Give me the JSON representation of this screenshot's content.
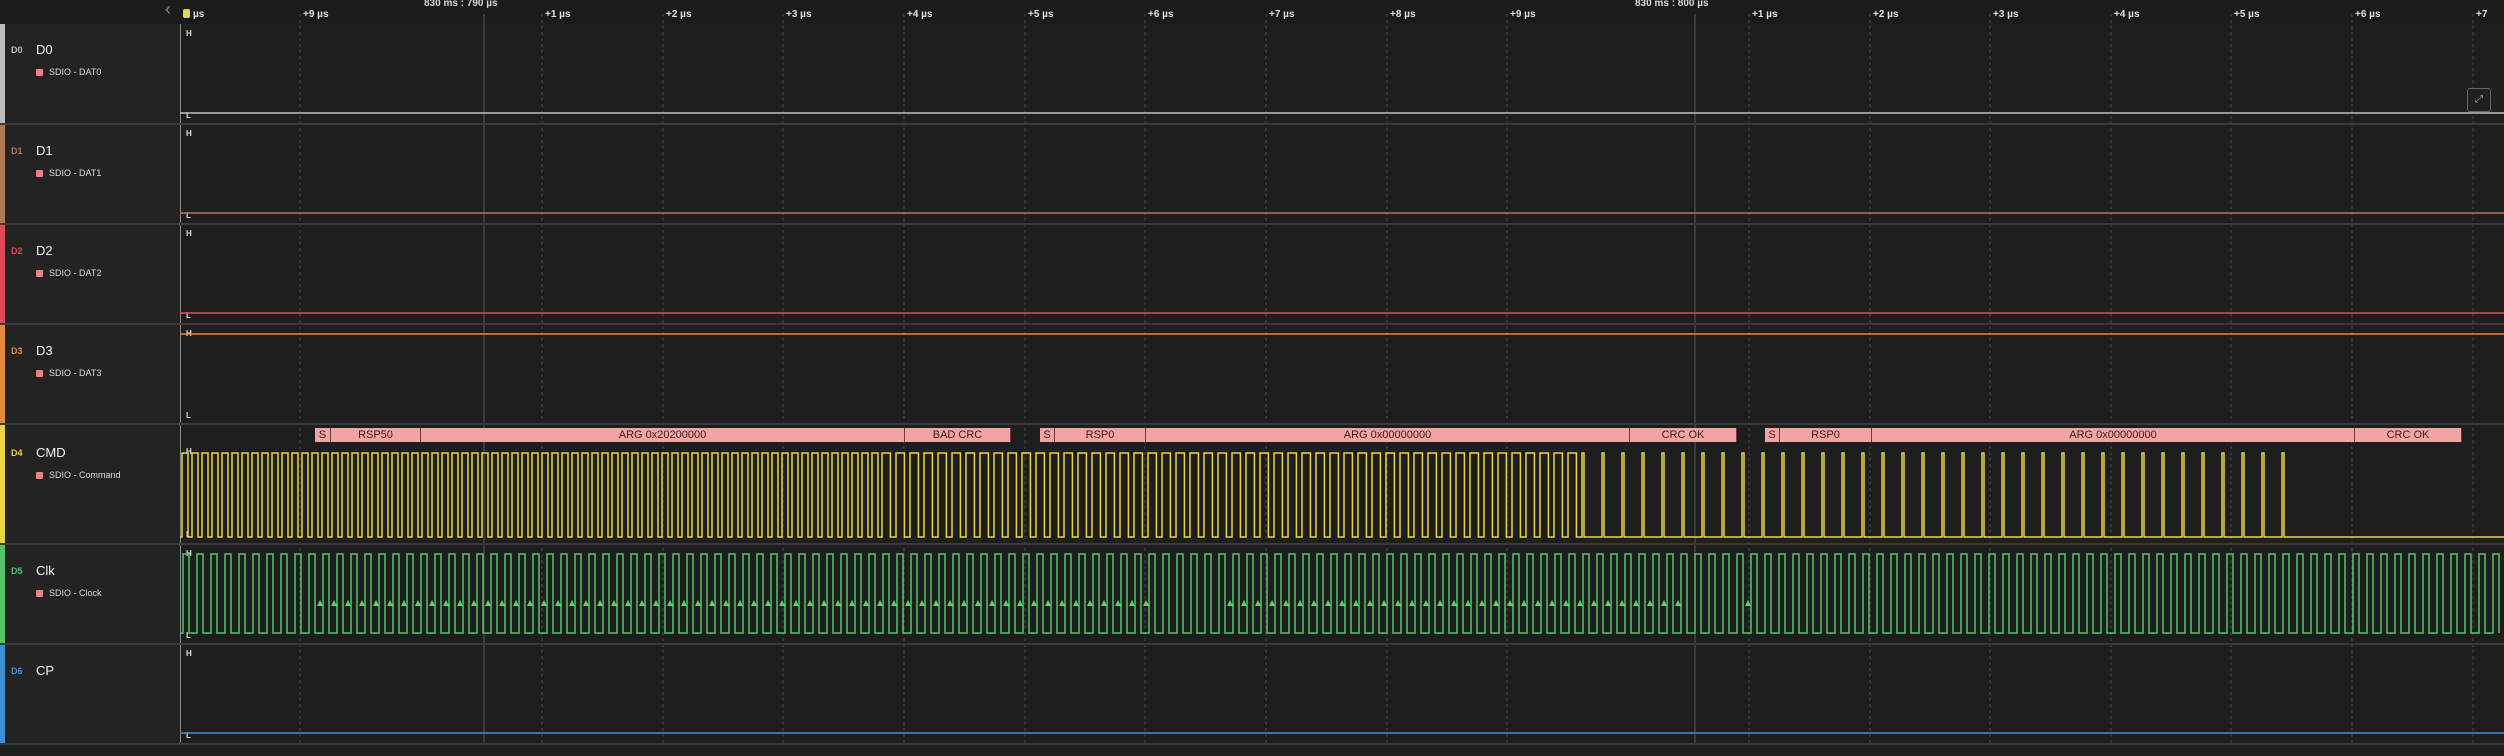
{
  "ruler": {
    "timestamps": [
      "830 ms : 790 µs",
      "830 ms : 800 µs"
    ],
    "cursor_label": "µs",
    "ticks": [
      "+9 µs",
      "+1 µs",
      "+2 µs",
      "+3 µs",
      "+4 µs",
      "+5 µs",
      "+6 µs",
      "+7 µs",
      "+8 µs",
      "+9 µs",
      "+1 µs",
      "+2 µs",
      "+3 µs",
      "+4 µs",
      "+5 µs",
      "+6 µs",
      "+7"
    ]
  },
  "channels": [
    {
      "id": "D0",
      "name": "D0",
      "analyzer": "SDIO - DAT0",
      "color": "#bdbdbd",
      "level_high": "H",
      "level_low": "L",
      "state": "low"
    },
    {
      "id": "D1",
      "name": "D1",
      "analyzer": "SDIO - DAT1",
      "color": "#b07a56",
      "level_high": "H",
      "level_low": "L",
      "state": "low"
    },
    {
      "id": "D2",
      "name": "D2",
      "analyzer": "SDIO - DAT2",
      "color": "#e0495a",
      "level_high": "H",
      "level_low": "L",
      "state": "low"
    },
    {
      "id": "D3",
      "name": "D3",
      "analyzer": "SDIO - DAT3",
      "color": "#e58a3c",
      "level_high": "H",
      "level_low": "L",
      "state": "high"
    },
    {
      "id": "D4",
      "name": "CMD",
      "analyzer": "SDIO - Command",
      "color": "#e8d548",
      "level_high": "H",
      "level_low": "L",
      "state": "toggling"
    },
    {
      "id": "D5",
      "name": "Clk",
      "analyzer": "SDIO - Clock",
      "color": "#54c667",
      "level_high": "H",
      "level_low": "L",
      "state": "clock"
    },
    {
      "id": "D6",
      "name": "CP",
      "analyzer": "",
      "color": "#3f8fd6",
      "level_high": "H",
      "level_low": "L",
      "state": "low"
    }
  ],
  "cmd_packets": [
    {
      "text": "S"
    },
    {
      "text": "RSP50"
    },
    {
      "text": "ARG 0x20200000"
    },
    {
      "text": "BAD CRC"
    },
    {
      "text": "S"
    },
    {
      "text": "RSP0"
    },
    {
      "text": "ARG 0x00000000"
    },
    {
      "text": "CRC OK"
    },
    {
      "text": "S"
    },
    {
      "text": "RSP0"
    },
    {
      "text": "ARG 0x00000000"
    },
    {
      "text": "CRC OK"
    }
  ],
  "side_button": {
    "label": "⤢"
  },
  "colors": {
    "background": "#1e1e1e",
    "packet": "#f2a4a4"
  }
}
